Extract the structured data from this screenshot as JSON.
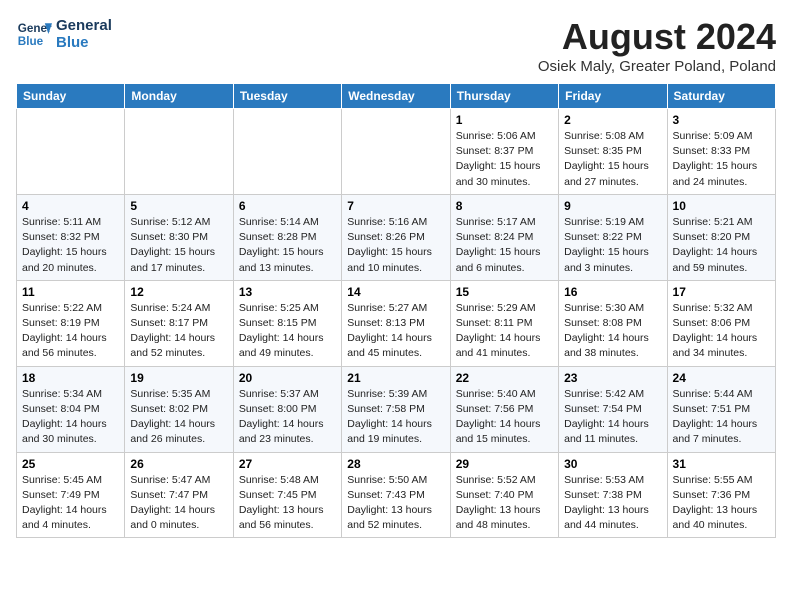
{
  "header": {
    "logo_line1": "General",
    "logo_line2": "Blue",
    "month_title": "August 2024",
    "location": "Osiek Maly, Greater Poland, Poland"
  },
  "weekdays": [
    "Sunday",
    "Monday",
    "Tuesday",
    "Wednesday",
    "Thursday",
    "Friday",
    "Saturday"
  ],
  "weeks": [
    [
      {
        "day": "",
        "info": ""
      },
      {
        "day": "",
        "info": ""
      },
      {
        "day": "",
        "info": ""
      },
      {
        "day": "",
        "info": ""
      },
      {
        "day": "1",
        "info": "Sunrise: 5:06 AM\nSunset: 8:37 PM\nDaylight: 15 hours\nand 30 minutes."
      },
      {
        "day": "2",
        "info": "Sunrise: 5:08 AM\nSunset: 8:35 PM\nDaylight: 15 hours\nand 27 minutes."
      },
      {
        "day": "3",
        "info": "Sunrise: 5:09 AM\nSunset: 8:33 PM\nDaylight: 15 hours\nand 24 minutes."
      }
    ],
    [
      {
        "day": "4",
        "info": "Sunrise: 5:11 AM\nSunset: 8:32 PM\nDaylight: 15 hours\nand 20 minutes."
      },
      {
        "day": "5",
        "info": "Sunrise: 5:12 AM\nSunset: 8:30 PM\nDaylight: 15 hours\nand 17 minutes."
      },
      {
        "day": "6",
        "info": "Sunrise: 5:14 AM\nSunset: 8:28 PM\nDaylight: 15 hours\nand 13 minutes."
      },
      {
        "day": "7",
        "info": "Sunrise: 5:16 AM\nSunset: 8:26 PM\nDaylight: 15 hours\nand 10 minutes."
      },
      {
        "day": "8",
        "info": "Sunrise: 5:17 AM\nSunset: 8:24 PM\nDaylight: 15 hours\nand 6 minutes."
      },
      {
        "day": "9",
        "info": "Sunrise: 5:19 AM\nSunset: 8:22 PM\nDaylight: 15 hours\nand 3 minutes."
      },
      {
        "day": "10",
        "info": "Sunrise: 5:21 AM\nSunset: 8:20 PM\nDaylight: 14 hours\nand 59 minutes."
      }
    ],
    [
      {
        "day": "11",
        "info": "Sunrise: 5:22 AM\nSunset: 8:19 PM\nDaylight: 14 hours\nand 56 minutes."
      },
      {
        "day": "12",
        "info": "Sunrise: 5:24 AM\nSunset: 8:17 PM\nDaylight: 14 hours\nand 52 minutes."
      },
      {
        "day": "13",
        "info": "Sunrise: 5:25 AM\nSunset: 8:15 PM\nDaylight: 14 hours\nand 49 minutes."
      },
      {
        "day": "14",
        "info": "Sunrise: 5:27 AM\nSunset: 8:13 PM\nDaylight: 14 hours\nand 45 minutes."
      },
      {
        "day": "15",
        "info": "Sunrise: 5:29 AM\nSunset: 8:11 PM\nDaylight: 14 hours\nand 41 minutes."
      },
      {
        "day": "16",
        "info": "Sunrise: 5:30 AM\nSunset: 8:08 PM\nDaylight: 14 hours\nand 38 minutes."
      },
      {
        "day": "17",
        "info": "Sunrise: 5:32 AM\nSunset: 8:06 PM\nDaylight: 14 hours\nand 34 minutes."
      }
    ],
    [
      {
        "day": "18",
        "info": "Sunrise: 5:34 AM\nSunset: 8:04 PM\nDaylight: 14 hours\nand 30 minutes."
      },
      {
        "day": "19",
        "info": "Sunrise: 5:35 AM\nSunset: 8:02 PM\nDaylight: 14 hours\nand 26 minutes."
      },
      {
        "day": "20",
        "info": "Sunrise: 5:37 AM\nSunset: 8:00 PM\nDaylight: 14 hours\nand 23 minutes."
      },
      {
        "day": "21",
        "info": "Sunrise: 5:39 AM\nSunset: 7:58 PM\nDaylight: 14 hours\nand 19 minutes."
      },
      {
        "day": "22",
        "info": "Sunrise: 5:40 AM\nSunset: 7:56 PM\nDaylight: 14 hours\nand 15 minutes."
      },
      {
        "day": "23",
        "info": "Sunrise: 5:42 AM\nSunset: 7:54 PM\nDaylight: 14 hours\nand 11 minutes."
      },
      {
        "day": "24",
        "info": "Sunrise: 5:44 AM\nSunset: 7:51 PM\nDaylight: 14 hours\nand 7 minutes."
      }
    ],
    [
      {
        "day": "25",
        "info": "Sunrise: 5:45 AM\nSunset: 7:49 PM\nDaylight: 14 hours\nand 4 minutes."
      },
      {
        "day": "26",
        "info": "Sunrise: 5:47 AM\nSunset: 7:47 PM\nDaylight: 14 hours\nand 0 minutes."
      },
      {
        "day": "27",
        "info": "Sunrise: 5:48 AM\nSunset: 7:45 PM\nDaylight: 13 hours\nand 56 minutes."
      },
      {
        "day": "28",
        "info": "Sunrise: 5:50 AM\nSunset: 7:43 PM\nDaylight: 13 hours\nand 52 minutes."
      },
      {
        "day": "29",
        "info": "Sunrise: 5:52 AM\nSunset: 7:40 PM\nDaylight: 13 hours\nand 48 minutes."
      },
      {
        "day": "30",
        "info": "Sunrise: 5:53 AM\nSunset: 7:38 PM\nDaylight: 13 hours\nand 44 minutes."
      },
      {
        "day": "31",
        "info": "Sunrise: 5:55 AM\nSunset: 7:36 PM\nDaylight: 13 hours\nand 40 minutes."
      }
    ]
  ]
}
